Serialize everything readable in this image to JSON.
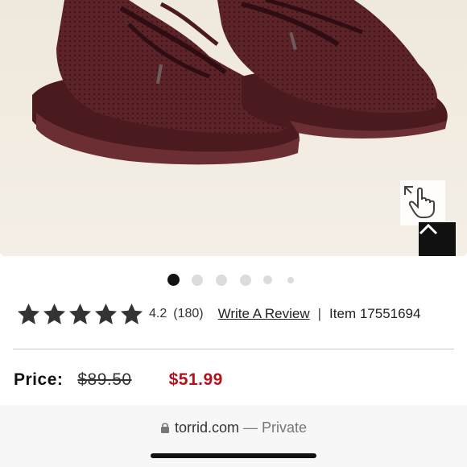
{
  "gallery": {
    "total_images": 6,
    "active_index": 0
  },
  "rating": {
    "stars": 5,
    "value": "4.2",
    "count": "(180)",
    "write_review_label": "Write A Review",
    "separator": "|",
    "item_label": "Item 17551694"
  },
  "price": {
    "label": "Price:",
    "original": "$89.50",
    "sale": "$51.99"
  },
  "browser": {
    "domain": "torrid.com",
    "mode": "— Private"
  },
  "colors": {
    "sale": "#b3121b",
    "shoe": "#5a2227",
    "background": "#f2ece0"
  }
}
